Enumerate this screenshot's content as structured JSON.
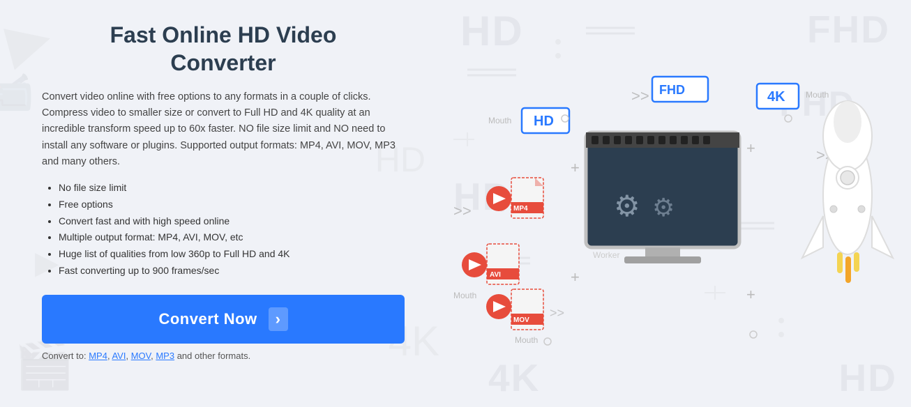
{
  "header": {
    "title_line1": "Fast Online HD Video",
    "title_line2": "Converter"
  },
  "description": "Convert video online with free options to any formats in a couple of clicks. Compress video to smaller size or convert to Full HD and 4K quality at an incredible transform speed up to 60x faster. NO file size limit and NO need to install any software or plugins. Supported output formats: MP4, AVI, MOV, MP3 and many others.",
  "features": [
    "No file size limit",
    "Free options",
    "Convert fast and with high speed online",
    "Multiple output format: MP4, AVI, MOV, etc",
    "Huge list of qualities from low 360p to Full HD and 4K",
    "Fast converting up to 900 frames/sec"
  ],
  "convert_button": {
    "label": "Convert Now",
    "arrow": "›"
  },
  "format_links": {
    "prefix": "Convert to: ",
    "formats": [
      "MP4",
      "AVI",
      "MOV",
      "MP3"
    ],
    "suffix": " and other formats."
  },
  "illustration": {
    "quality_badges": [
      "HD",
      "FHD",
      "4K"
    ],
    "file_formats": [
      "MP4",
      "AVI",
      "MOV"
    ],
    "mouth_labels": [
      "Mouth",
      "Mouth",
      "Mouth"
    ],
    "worker_label": "Worker",
    "colors": {
      "blue_accent": "#2979ff",
      "red_badge": "#e74c3c",
      "dark_bg": "#2c3e50"
    }
  }
}
